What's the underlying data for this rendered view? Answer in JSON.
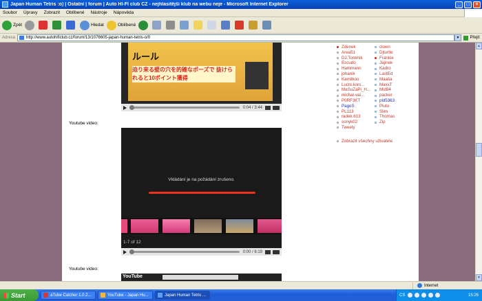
{
  "window": {
    "title": "Japan Human Tetris :o) | Ostatní | forum | Auto HI-FI club CZ - nejhlasitější klub na webu neje - Microsoft Internet Explorer",
    "min": "_",
    "max": "□",
    "close": "×"
  },
  "menu": [
    "Soubor",
    "Úpravy",
    "Zobrazit",
    "Oblíbené",
    "Nástroje",
    "Nápověda"
  ],
  "toolbar": {
    "back": "Zpět",
    "search": "Hledat",
    "favorites": "Oblíbené"
  },
  "address": {
    "label": "Adresa",
    "url": "http://www.autohificlub.cz/forum/13/1076605-japan-human-tetris-o/0",
    "go": "Přejít"
  },
  "videos": [
    {
      "banner_title": "ルール",
      "banner_text": "迫り来る壁の穴を的確なポーズで 抜けられると10ポイント獲得",
      "time": "0:04 / 3:44"
    },
    {
      "label": "Youtube video:",
      "message": "Vkládání je na požádání zrušeno.",
      "count": "1-7 of 12",
      "time": "0:00 / 6:19"
    },
    {
      "label": "Youtube video:",
      "logo": "YouTube"
    }
  ],
  "users": {
    "col1": [
      {
        "name": "Zdenek",
        "online": true
      },
      {
        "name": "Area51",
        "online": false
      },
      {
        "name": "DJ.Tommik",
        "online": false
      },
      {
        "name": "Escudo",
        "online": false
      },
      {
        "name": "Hammann",
        "online": false
      },
      {
        "name": "johanik",
        "online": false
      },
      {
        "name": "Kamilkoo",
        "online": false
      },
      {
        "name": "Lucni.koni...",
        "online": false
      },
      {
        "name": "MaSuZaPi_H...",
        "online": false
      },
      {
        "name": "michal-val...",
        "online": false
      },
      {
        "name": "P0RF3KT",
        "online": false
      },
      {
        "name": "PagoS",
        "online": false,
        "blue": true
      },
      {
        "name": "PL113",
        "online": false
      },
      {
        "name": "radek.613",
        "online": false
      },
      {
        "name": "sonyk02",
        "online": false
      },
      {
        "name": "Tweety",
        "online": false
      }
    ],
    "col2": [
      {
        "name": "clown",
        "online": false
      },
      {
        "name": "Djturtle",
        "online": false
      },
      {
        "name": "Frankie",
        "online": true
      },
      {
        "name": "Jajinek",
        "online": false
      },
      {
        "name": "Kadro",
        "online": false
      },
      {
        "name": "LastEd",
        "online": false
      },
      {
        "name": "Maaša",
        "online": false
      },
      {
        "name": "MaxxT",
        "online": false
      },
      {
        "name": "Mid84",
        "online": false
      },
      {
        "name": "packer",
        "online": false
      },
      {
        "name": "pld5363",
        "online": false,
        "blue": true
      },
      {
        "name": "Pluto",
        "online": false
      },
      {
        "name": "Slim",
        "online": false
      },
      {
        "name": "Thomas",
        "online": false
      },
      {
        "name": "Zip",
        "online": false
      }
    ],
    "show_all": "Zobrazit všechny uživatele"
  },
  "status": {
    "zone": "Internet"
  },
  "taskbar": {
    "start": "Start",
    "tasks": [
      "aTube Catcher 1.0.2...",
      "YouTube - Japan Hu...",
      "Japan Human Tetris ..."
    ],
    "lang": "CS",
    "clock": "15:26"
  },
  "colors": {
    "page_bg": "#8a6b7c",
    "accent": "#c0392b",
    "red_bar": "#e8351b"
  }
}
